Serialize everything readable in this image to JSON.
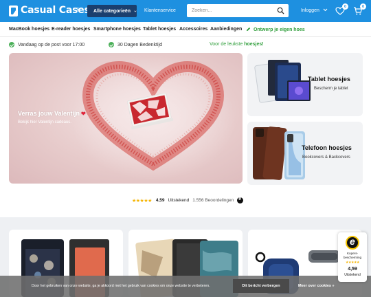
{
  "header": {
    "logo": "Casual Cases",
    "logo_badge": "NL",
    "categories_button": "Alle categorieën",
    "customer_service": "Klantenservice",
    "search_placeholder": "Zoeken...",
    "login": "Inloggen",
    "wishlist_count": "0",
    "cart_count": "0",
    "brand_color": "#1e90e0"
  },
  "nav": {
    "items": [
      "MacBook hoesjes",
      "E-reader hoesjes",
      "Smartphone hoesjes",
      "Tablet hoesjes",
      "Accessoires",
      "Aanbiedingen"
    ],
    "design": "Ontwerp je eigen hoes"
  },
  "usp": {
    "shipping": "Vandaag op de post voor 17:00",
    "returns": "30 Dagen Bedenktijd",
    "best_prefix": "Voor de leukste",
    "best_bold": "hoesjes!"
  },
  "hero": {
    "title": "Verras jouw Valentijn",
    "subtitle": "Bekijk hier Valentijn cadeaus."
  },
  "cards": [
    {
      "title": "Tablet hoesjes",
      "subtitle": "Bescherm je tablet"
    },
    {
      "title": "Telefoon hoesjes",
      "subtitle": "Bookcovers & Backcovers"
    }
  ],
  "reviews": {
    "stars": "★★★★★",
    "score": "4,59",
    "label": "Uitstekend",
    "count": "1.556 Beoordelingen"
  },
  "cookie": {
    "text": "Door het gebruiken van onze website, ga je akkoord met het gebruik van cookies om onze website te verbeteren.",
    "hide_button": "Dit bericht verbergen",
    "more": "Meer over cookies »"
  },
  "trust_badge": {
    "label_line1": "Kopers-",
    "label_line2": "bescherming",
    "stars": "★★★★★",
    "score": "4,59",
    "word": "Uitstekend"
  }
}
